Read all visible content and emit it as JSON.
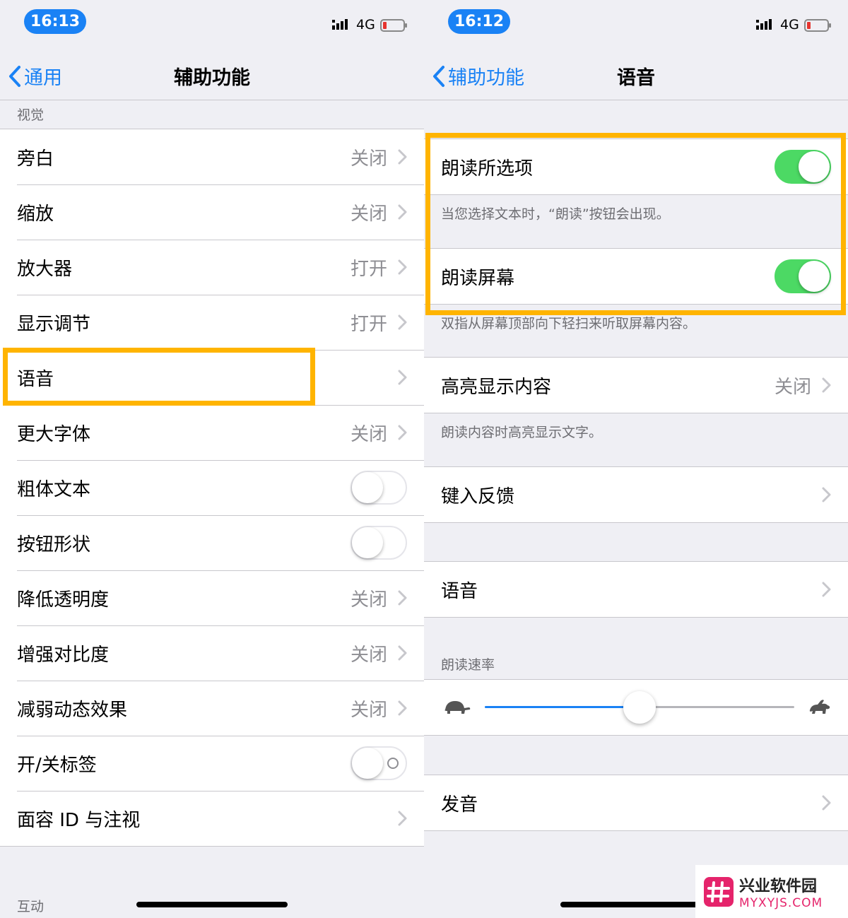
{
  "left": {
    "status": {
      "time": "16:13",
      "network": "4G"
    },
    "nav": {
      "back": "通用",
      "title": "辅助功能"
    },
    "section_vision": "视觉",
    "rows": [
      {
        "label": "旁白",
        "value": "关闭"
      },
      {
        "label": "缩放",
        "value": "关闭"
      },
      {
        "label": "放大器",
        "value": "打开"
      },
      {
        "label": "显示调节",
        "value": "打开"
      },
      {
        "label": "语音",
        "value": ""
      },
      {
        "label": "更大字体",
        "value": "关闭"
      },
      {
        "label": "粗体文本",
        "toggle": false
      },
      {
        "label": "按钮形状",
        "toggle": false
      },
      {
        "label": "降低透明度",
        "value": "关闭"
      },
      {
        "label": "增强对比度",
        "value": "关闭"
      },
      {
        "label": "减弱动态效果",
        "value": "关闭"
      },
      {
        "label": "开/关标签",
        "toggle": false
      },
      {
        "label": "面容 ID 与注视",
        "value": ""
      }
    ],
    "section_interaction": "互动"
  },
  "right": {
    "status": {
      "time": "16:12",
      "network": "4G"
    },
    "nav": {
      "back": "辅助功能",
      "title": "语音"
    },
    "speak_selection": {
      "label": "朗读所选项",
      "toggle": true,
      "footer": "当您选择文本时，“朗读”按钮会出现。"
    },
    "speak_screen": {
      "label": "朗读屏幕",
      "toggle": true,
      "footer": "双指从屏幕顶部向下轻扫来听取屏幕内容。"
    },
    "highlight_content": {
      "label": "高亮显示内容",
      "value": "关闭",
      "footer": "朗读内容时高亮显示文字。"
    },
    "typing_feedback": {
      "label": "键入反馈"
    },
    "voices": {
      "label": "语音"
    },
    "speaking_rate": {
      "label": "朗读速率",
      "value": 0.5
    },
    "pronunciations": {
      "label": "发音"
    }
  },
  "watermark": {
    "cn": "兴业软件园",
    "en": "MYXYJS.COM"
  },
  "colors": {
    "accent": "#1a82f5",
    "toggle_on": "#4cd964",
    "highlight_box": "#ffb400"
  }
}
